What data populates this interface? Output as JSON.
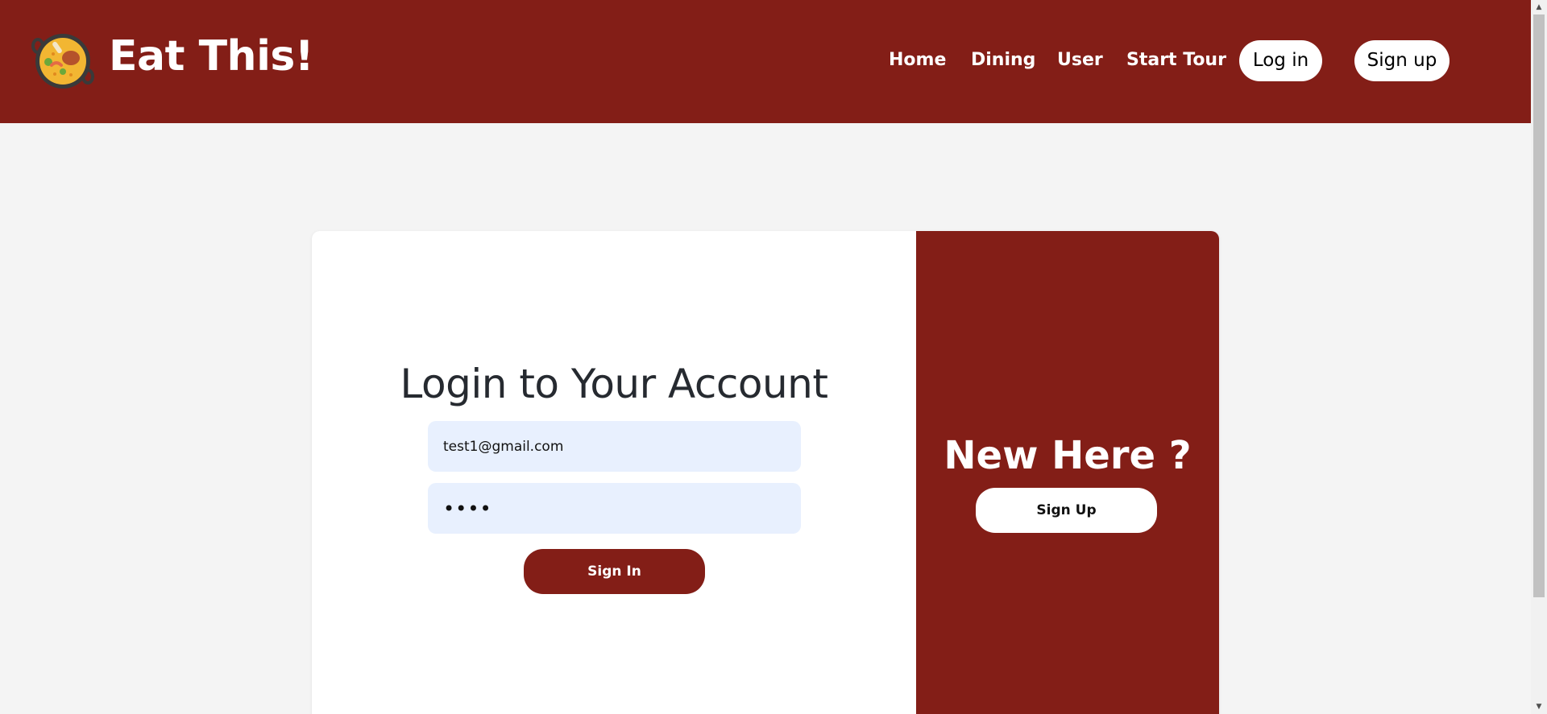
{
  "header": {
    "brand": "Eat This!",
    "logo_icon": "paella-pan-icon",
    "nav": [
      {
        "label": "Home"
      },
      {
        "label": "Dining"
      },
      {
        "label": "User"
      },
      {
        "label": "Start Tour"
      }
    ],
    "login_label": "Log in",
    "signup_label": "Sign up"
  },
  "login": {
    "title": "Login to Your Account",
    "email_value": "test1@gmail.com",
    "password_value": "••••",
    "submit_label": "Sign In"
  },
  "promo": {
    "title": "New Here ?",
    "button_label": "Sign Up"
  },
  "colors": {
    "brand": "#831e17",
    "background": "#f4f4f4",
    "input_bg": "#e8f0fe"
  }
}
